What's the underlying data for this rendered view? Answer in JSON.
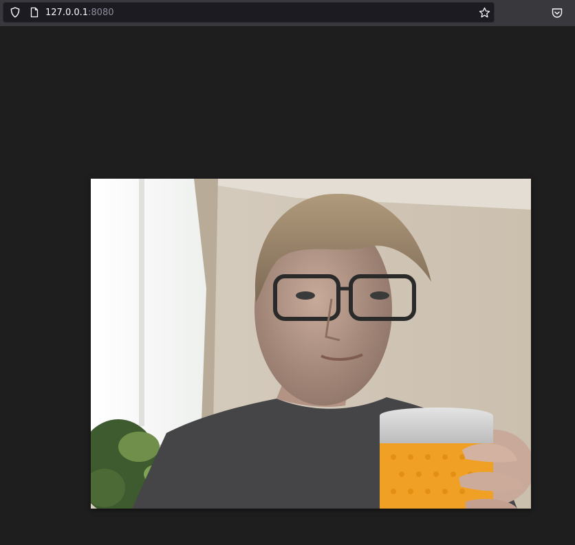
{
  "browser": {
    "url_host": "127.0.0.1",
    "url_port": ":8080",
    "icons": {
      "tracking_protection": "shield-icon",
      "page": "page-icon",
      "bookmark": "star-icon",
      "pocket": "pocket-icon"
    }
  },
  "colors": {
    "toolbar": "#38383d",
    "urlbar": "#1c1b22",
    "page_background": "#1e1e1e"
  },
  "page": {
    "video": {
      "description_icon": "webcam-video-feed"
    }
  }
}
